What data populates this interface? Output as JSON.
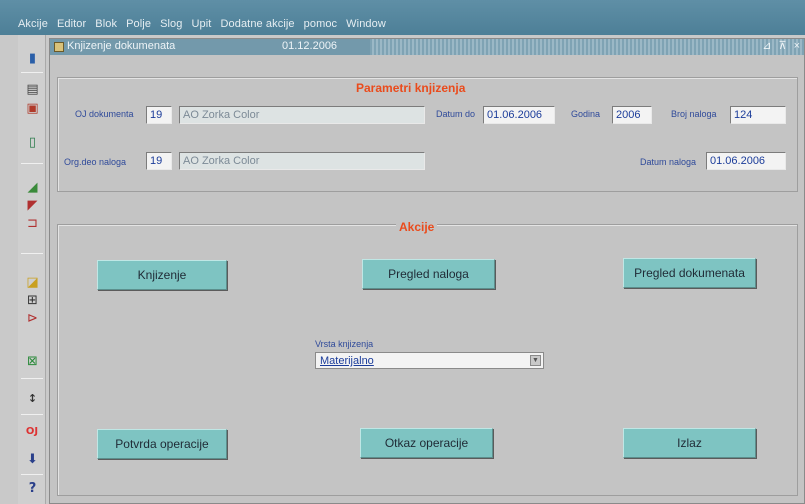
{
  "menu": [
    "Akcije",
    "Editor",
    "Blok",
    "Polje",
    "Slog",
    "Upit",
    "Dodatne akcije",
    "pomoc",
    "Window"
  ],
  "window": {
    "title": "Knjizenje dokumenata",
    "date": "01.12.2006",
    "controls": "⊿ ⊼ ×"
  },
  "params": {
    "title": "Parametri knjizenja",
    "oj_dokumenta": {
      "label": "OJ dokumenta",
      "code": "19",
      "name": "AO Zorka Color"
    },
    "datum_do": {
      "label": "Datum do",
      "value": "01.06.2006"
    },
    "godina": {
      "label": "Godina",
      "value": "2006"
    },
    "broj_naloga": {
      "label": "Broj naloga",
      "value": "124"
    },
    "org_deo_naloga": {
      "label": "Org.deo naloga",
      "code": "19",
      "name": "AO Zorka Color"
    },
    "datum_naloga": {
      "label": "Datum naloga",
      "value": "01.06.2006"
    }
  },
  "actions": {
    "title": "Akcije",
    "knjizenje": "Knjizenje",
    "pregled_naloga": "Pregled naloga",
    "pregled_dokumenata": "Pregled dokumenata",
    "vrsta_label": "Vrsta knjizenja",
    "vrsta_value": "Materijalno",
    "potvrda": "Potvrda operacije",
    "otkaz": "Otkaz operacije",
    "izlaz": "Izlaz"
  },
  "toolbar_icons": [
    "save-icon",
    "print-icon",
    "print-preview-icon",
    "exit-door-icon",
    "insert-record-icon",
    "edit-record-icon",
    "delete-record-icon",
    "query-icon",
    "find-icon",
    "run-icon",
    "excel-icon",
    "sort-icon",
    "oj-icon",
    "download-icon",
    "help-icon"
  ],
  "toolbar_oj_text": "OJ",
  "colors": {
    "menubar": "#4d7f97",
    "button": "#7ec4c2",
    "section_title": "#ea4b1c",
    "label": "#2f4a9a",
    "field_text": "#1b3c9a"
  }
}
